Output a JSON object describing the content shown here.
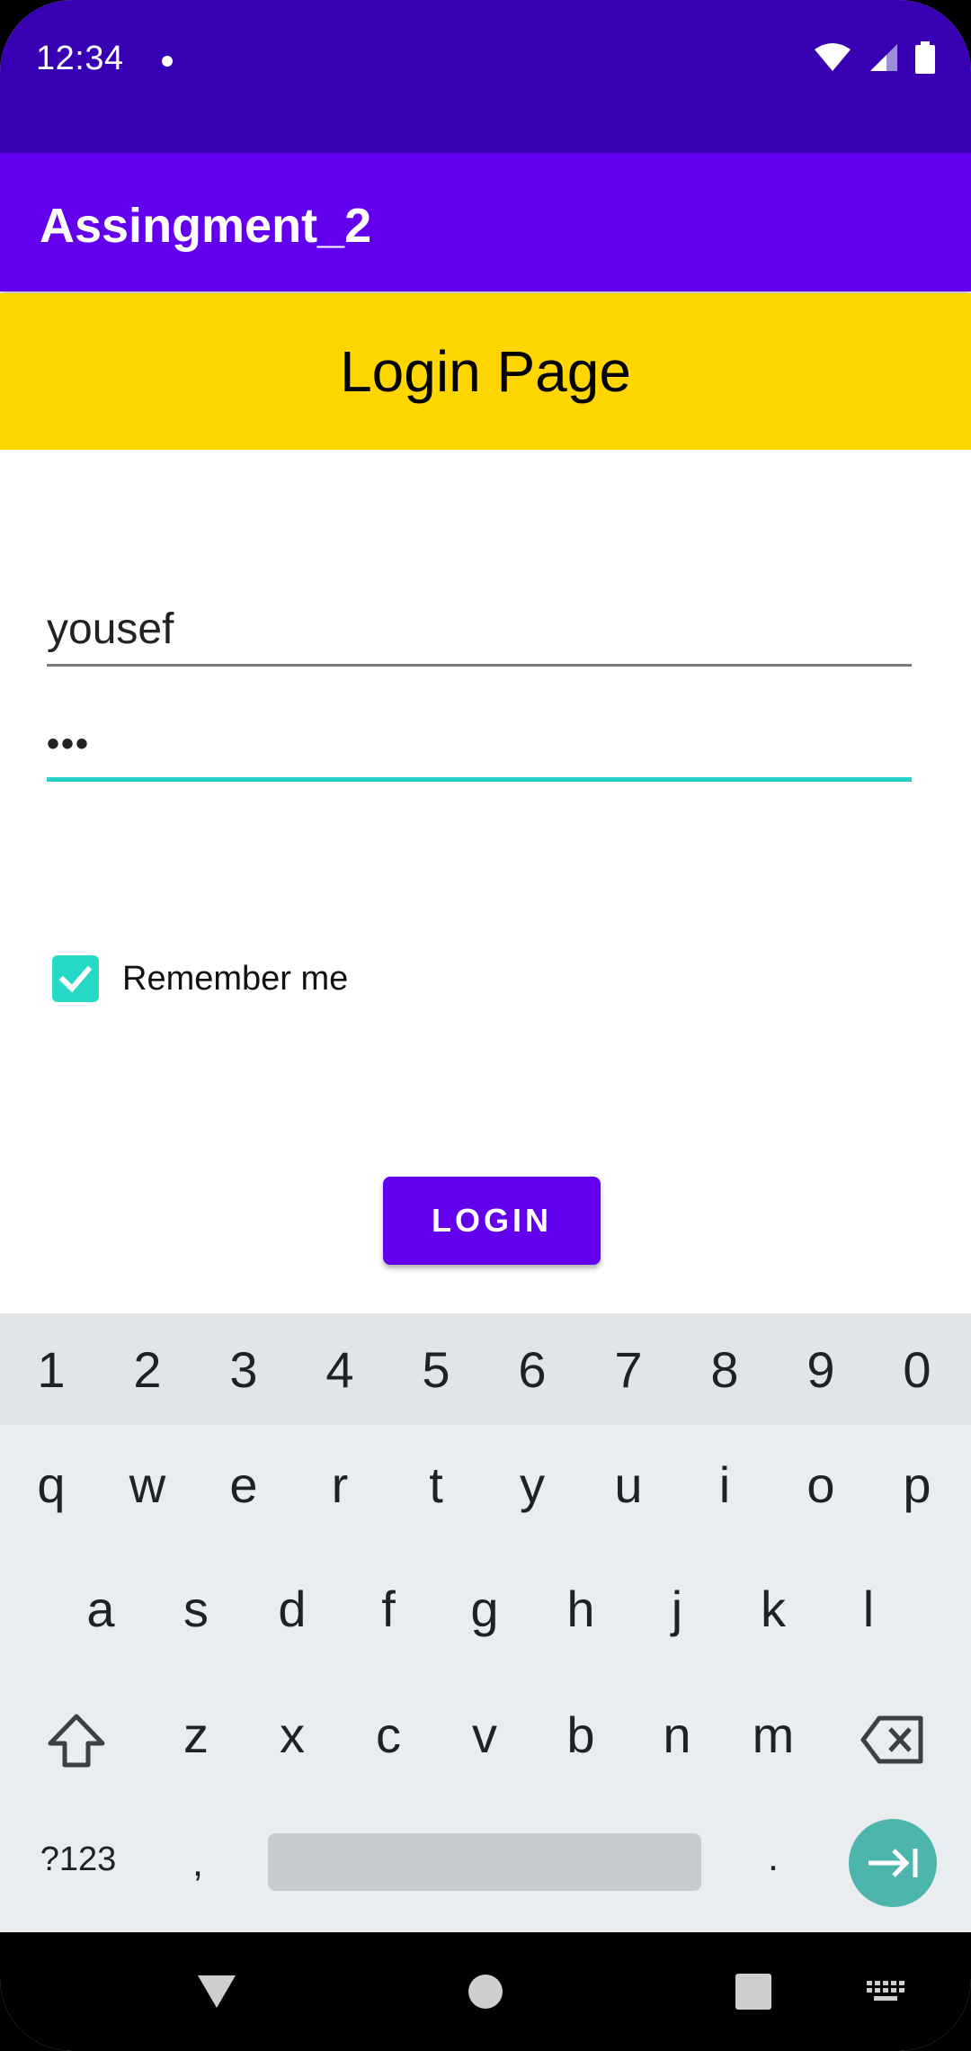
{
  "status_bar": {
    "time": "12:34",
    "icons": [
      "notification-dot-icon",
      "wifi-icon",
      "cell-signal-icon",
      "battery-icon"
    ]
  },
  "app_bar": {
    "title": "Assingment_2"
  },
  "login_header": {
    "title": "Login Page"
  },
  "form": {
    "username_value": "yousef",
    "password_value": "•••",
    "remember_me_label": "Remember me",
    "remember_me_checked": true,
    "login_button_label": "LOGIN"
  },
  "keyboard": {
    "number_row": [
      "1",
      "2",
      "3",
      "4",
      "5",
      "6",
      "7",
      "8",
      "9",
      "0"
    ],
    "row1": [
      "q",
      "w",
      "e",
      "r",
      "t",
      "y",
      "u",
      "i",
      "o",
      "p"
    ],
    "row2": [
      "a",
      "s",
      "d",
      "f",
      "g",
      "h",
      "j",
      "k",
      "l"
    ],
    "row3": [
      "z",
      "x",
      "c",
      "v",
      "b",
      "n",
      "m"
    ],
    "symbols_key": "?123",
    "comma_key": ",",
    "period_key": "."
  },
  "colors": {
    "status_bar": "#3700B3",
    "app_bar": "#6200EE",
    "header": "#FFD600",
    "accent": "#26D0C9",
    "enter_key": "#4DB6AC"
  }
}
